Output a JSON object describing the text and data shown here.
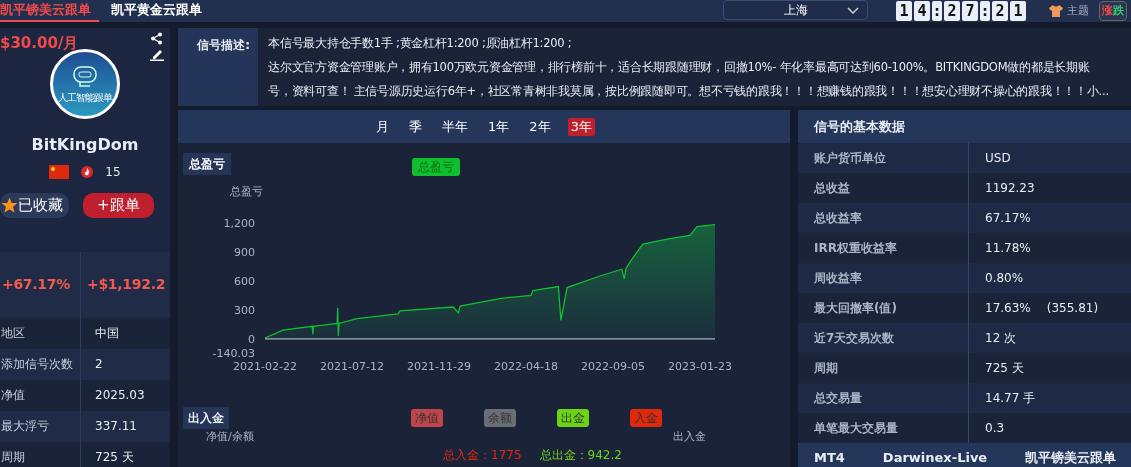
{
  "top_tabs": [
    {
      "label": "凯平镑美云跟单",
      "selected": true
    },
    {
      "label": "凯平黄金云跟单",
      "selected": false
    }
  ],
  "city_select": {
    "value": "上海"
  },
  "clock": [
    "1",
    "4",
    ":",
    "2",
    "7",
    ":",
    "2",
    "1"
  ],
  "theme_button": "主题",
  "updown_toggle": [
    "涨",
    "跌"
  ],
  "profile": {
    "price": "$30.00/月",
    "avatar_caption": "人工智能跟单",
    "name": "BitKingDom",
    "heat": "15",
    "favorite_button": {
      "label": "已收藏",
      "on": true
    },
    "follow_button": "+跟单",
    "total_return": "+67.17%",
    "total_profit": "+$1,192.2",
    "details": [
      {
        "label": "地区",
        "value": "中国"
      },
      {
        "label": "添加信号次数",
        "value": "2"
      },
      {
        "label": "净值",
        "value": "2025.03"
      },
      {
        "label": "最大浮亏",
        "value": "337.11"
      },
      {
        "label": "周期",
        "value": "725 天"
      }
    ]
  },
  "description": {
    "label": "信号描述:",
    "lines": [
      "本信号最大持仓手数1手 ;黄金杠杆1:200 ;原油杠杆1:200 ;",
      "达尔文官方资金管理账户，拥有100万欧元资金管理，排行榜前十，适合长期跟随理财，回撤10%- 年化率最高可达到60-100%。BITKINGDOM做的都是长期账号，资料可查！ 主信号源历史运行6年+，社区常青树非我莫属，按比例跟随即可。想不亏钱的跟我！！！想赚钱的跟我！！！想安心理财不操心的跟我！！！小..."
    ]
  },
  "periods": [
    {
      "label": "月",
      "selected": false
    },
    {
      "label": "季",
      "selected": false
    },
    {
      "label": "半年",
      "selected": false
    },
    {
      "label": "1年",
      "selected": false
    },
    {
      "label": "2年",
      "selected": false
    },
    {
      "label": "3年",
      "selected": true
    }
  ],
  "pnl_chart": {
    "section_label": "总盈亏",
    "chart_data": {
      "type": "area",
      "ylabel": "总盈亏",
      "x": [
        "2021-02-22",
        "2021-03-23",
        "2021-05-09",
        "2021-05-10",
        "2021-05-11",
        "2021-06-18",
        "2021-06-19",
        "2021-06-20",
        "2021-06-21",
        "2021-07-20",
        "2021-09-24",
        "2021-09-27",
        "2021-12-22",
        "2021-12-30",
        "2022-01-02",
        "2022-03-09",
        "2022-04-26",
        "2022-04-29",
        "2022-06-09",
        "2022-06-13",
        "2022-06-23",
        "2022-08-15",
        "2022-09-19",
        "2022-09-23",
        "2022-09-26",
        "2022-10-07",
        "2022-10-23",
        "2022-12-01",
        "2023-01-07",
        "2023-01-18",
        "2023-02-16"
      ],
      "series": [
        {
          "name": "总盈亏",
          "color": "#0fbf2c",
          "values": [
            10,
            90,
            130,
            50,
            130,
            160,
            320,
            30,
            160,
            210,
            260,
            290,
            330,
            270,
            340,
            420,
            450,
            500,
            540,
            190,
            530,
            650,
            720,
            620,
            730,
            840,
            980,
            1030,
            1070,
            1160,
            1180
          ]
        }
      ],
      "xlim": [
        "2021-02-22",
        "2023-02-16"
      ],
      "ylim": [
        -140.03,
        1200
      ],
      "xticks": [
        "2021-02-22",
        "2021-07-12",
        "2021-11-29",
        "2022-04-18",
        "2022-09-05",
        "2023-01-23"
      ],
      "yticks": [
        {
          "value": -140.03,
          "label": "-140.03"
        },
        {
          "value": 0,
          "label": "0"
        },
        {
          "value": 300,
          "label": "300"
        },
        {
          "value": 600,
          "label": "600"
        },
        {
          "value": 900,
          "label": "900"
        },
        {
          "value": 1200,
          "label": "1,200"
        }
      ]
    }
  },
  "cashflow": {
    "section_label": "出入金",
    "legend": [
      {
        "label": "净值",
        "color": "#c0454a"
      },
      {
        "label": "余额",
        "color": "#6b6f75"
      },
      {
        "label": "出金",
        "color": "#6cd417"
      },
      {
        "label": "入金",
        "color": "#e0280c"
      }
    ],
    "left_axis_title": "净值/余额",
    "right_axis_title": "出入金",
    "total_in": "总入金：1775",
    "total_out": "总出金：942.2"
  },
  "basic_data": {
    "title": "信号的基本数据",
    "rows": [
      {
        "label": "账户货币单位",
        "value": "USD"
      },
      {
        "label": "总收益",
        "value": "1192.23"
      },
      {
        "label": "总收益率",
        "value": "67.17%"
      },
      {
        "label": "IRR权重收益率",
        "value": "11.78%"
      },
      {
        "label": "周收益率",
        "value": "0.80%"
      },
      {
        "label": "最大回撤率(值)",
        "value": "17.63%",
        "extra": "(355.81)"
      },
      {
        "label": "近7天交易次数",
        "value": "12 次"
      },
      {
        "label": "周期",
        "value": "725 天"
      },
      {
        "label": "总交易量",
        "value": "14.77 手"
      },
      {
        "label": "单笔最大交易量",
        "value": "0.3"
      }
    ],
    "footer": [
      "MT4",
      "Darwinex-Live",
      "凯平镑美云跟单"
    ]
  }
}
